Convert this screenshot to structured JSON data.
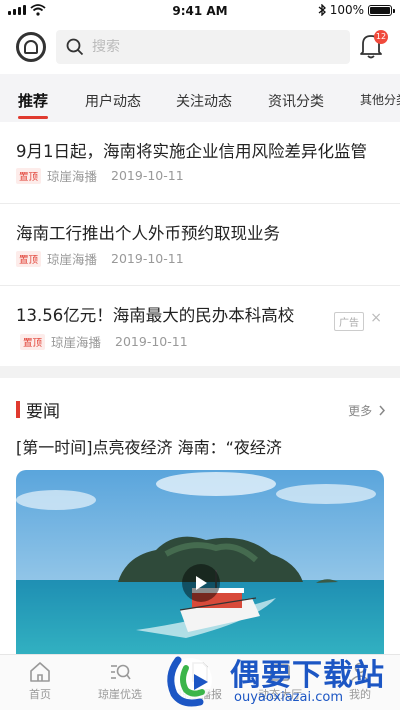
{
  "status_bar": {
    "time": "9:41 AM",
    "battery": "100%"
  },
  "header": {
    "search_placeholder": "搜索",
    "notification_count": "12"
  },
  "tabs": [
    {
      "label": "推荐",
      "active": true
    },
    {
      "label": "用户动态"
    },
    {
      "label": "关注动态"
    },
    {
      "label": "资讯分类"
    },
    {
      "label": "其他分类"
    }
  ],
  "news": [
    {
      "title": "9月1日起，海南将实施企业信用风险差异化监管",
      "tag": "置顶",
      "source": "琼崖海播",
      "date": "2019-10-11"
    },
    {
      "title": "海南工行推出个人外币预约取现业务",
      "tag": "置顶",
      "source": "琼崖海播",
      "date": "2019-10-11"
    },
    {
      "title": "13.56亿元！海南最大的民办本科高校",
      "tag": "置顶",
      "source": "琼崖海播",
      "date": "2019-10-11",
      "ad_label": "广告",
      "close": "×"
    }
  ],
  "section": {
    "title": "要闻",
    "more": "更多",
    "subtitle": "[第一时间]点亮夜经济 海南：“夜经济"
  },
  "bottom_nav": [
    {
      "label": "首页",
      "icon": "home-icon"
    },
    {
      "label": "琼崖优选",
      "icon": "search-list-icon"
    },
    {
      "label": "琼崖播报",
      "icon": "document-icon"
    },
    {
      "label": "动态大厅",
      "icon": "hall-icon"
    },
    {
      "label": "我的",
      "icon": "user-icon"
    }
  ],
  "watermark": {
    "title": "偶要下载站",
    "url": "ouyaoxiazai.com"
  },
  "colors": {
    "accent": "#e03a2f",
    "watermark": "#1c56c4"
  }
}
